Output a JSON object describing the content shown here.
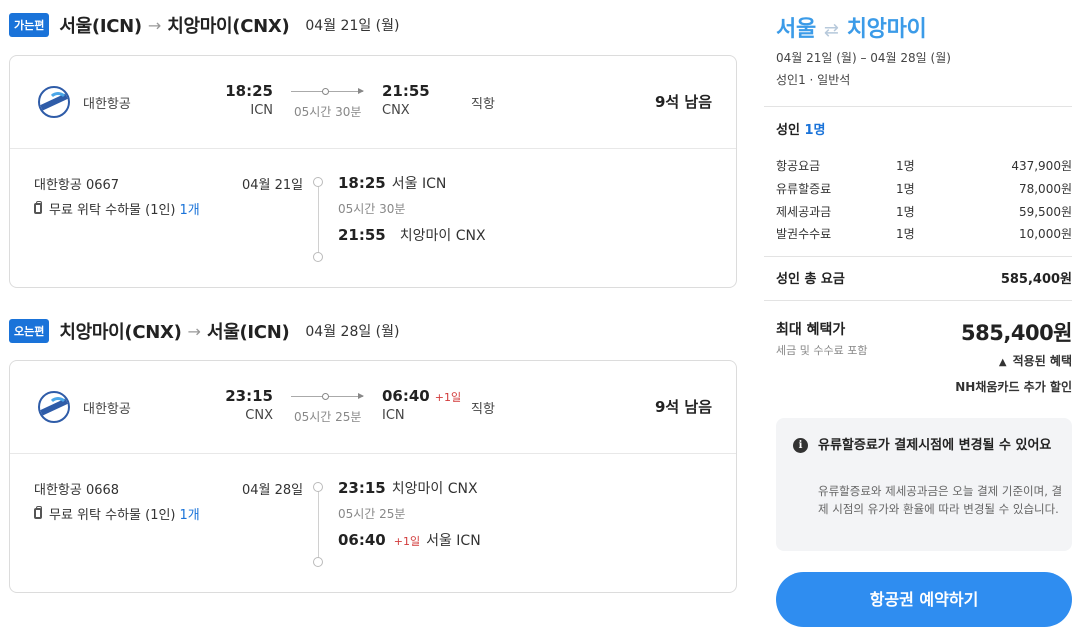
{
  "outbound": {
    "badge": "가는편",
    "from": "서울(ICN)",
    "arrow": "→",
    "to": "치앙마이(CNX)",
    "date": "04월 21일 (월)",
    "airline": "대한항공",
    "dep_time": "18:25",
    "dep_code": "ICN",
    "duration": "05시간 30분",
    "arr_time": "21:55",
    "arr_code": "CNX",
    "arr_plus_day": "",
    "direct": "직항",
    "seats": "9석 남음",
    "flight_no": "대한항공 0667",
    "baggage": "무료 위탁 수하물 (1인)",
    "baggage_count": "1개",
    "detail_date": "04월 21일",
    "detail_dep_time": "18:25",
    "detail_dep_place": "서울 ICN",
    "detail_duration": "05시간 30분",
    "detail_arr_time": "21:55",
    "detail_arr_plus_day": "",
    "detail_arr_place": "치앙마이 CNX"
  },
  "inbound": {
    "badge": "오는편",
    "from": "치앙마이(CNX)",
    "arrow": "→",
    "to": "서울(ICN)",
    "date": "04월 28일 (월)",
    "airline": "대한항공",
    "dep_time": "23:15",
    "dep_code": "CNX",
    "duration": "05시간 25분",
    "arr_time": "06:40",
    "arr_code": "ICN",
    "arr_plus_day": "+1일",
    "direct": "직항",
    "seats": "9석 남음",
    "flight_no": "대한항공 0668",
    "baggage": "무료 위탁 수하물 (1인)",
    "baggage_count": "1개",
    "detail_date": "04월 28일",
    "detail_dep_time": "23:15",
    "detail_dep_place": "치앙마이 CNX",
    "detail_duration": "05시간 25분",
    "detail_arr_time": "06:40",
    "detail_arr_plus_day": "+1일",
    "detail_arr_place": "서울 ICN"
  },
  "summary": {
    "origin": "서울",
    "swap_symbol": "⇄",
    "destination": "치앙마이",
    "dates": "04월 21일 (월) – 04월 28일 (월)",
    "passengers": "성인1 · 일반석",
    "adult_label": "성인",
    "adult_count": "1명",
    "fees": [
      {
        "name": "항공요금",
        "count": "1명",
        "amount": "437,900원"
      },
      {
        "name": "유류할증료",
        "count": "1명",
        "amount": "78,000원"
      },
      {
        "name": "제세공과금",
        "count": "1명",
        "amount": "59,500원"
      },
      {
        "name": "발권수수료",
        "count": "1명",
        "amount": "10,000원"
      }
    ],
    "total_label": "성인 총 요금",
    "total_amount": "585,400원",
    "max_label": "최대 혜택가",
    "max_sub": "세금 및 수수료 포함",
    "max_amount": "585,400원",
    "benefit_toggle": "적용된 혜택",
    "benefit_item": "NH채움카드 추가 할인"
  },
  "notice": {
    "icon_name": "info-icon",
    "title": "유류할증료가 결제시점에 변경될 수 있어요",
    "body": "유류할증료와 제세공과금은 오늘 결제 기준이며, 결제 시점의 유가와 환율에 따라 변경될 수 있습니다."
  },
  "book_button": "항공권 예약하기",
  "colors": {
    "accent": "#2f8df0",
    "badge": "#1a73d9",
    "title": "#3b9be8",
    "plus_day": "#d23b3b"
  }
}
